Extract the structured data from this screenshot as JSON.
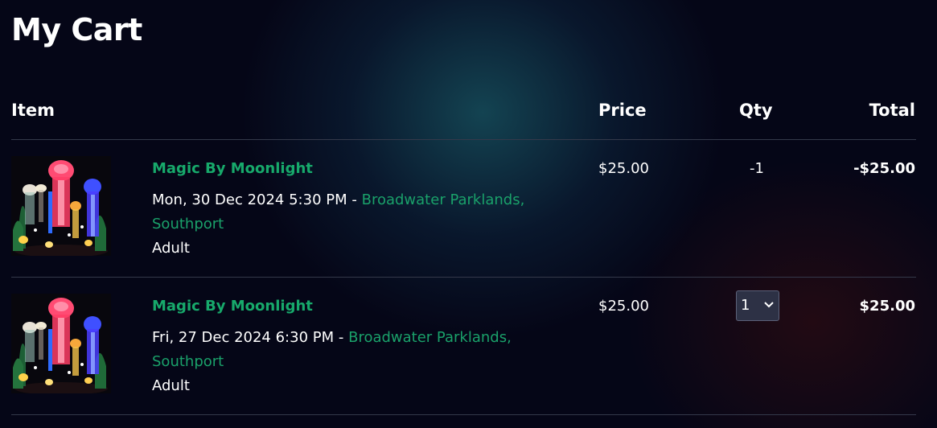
{
  "page": {
    "title": "My Cart"
  },
  "table": {
    "headers": {
      "item": "Item",
      "price": "Price",
      "qty": "Qty",
      "total": "Total"
    }
  },
  "cart_items": [
    {
      "image_icon": "lantern-jellyfish-photo",
      "event_name": "Magic By Moonlight",
      "datetime": "Mon, 30 Dec 2024 5:30 PM",
      "separator": "-",
      "venue": "Broadwater Parklands, Southport",
      "ticket_type": "Adult",
      "price": "$25.00",
      "qty": "-1",
      "total": "-$25.00"
    },
    {
      "image_icon": "lantern-jellyfish-photo",
      "event_name": "Magic By Moonlight",
      "datetime": "Fri, 27 Dec 2024 6:30 PM",
      "separator": "-",
      "venue": "Broadwater Parklands, Southport",
      "ticket_type": "Adult",
      "price": "$25.00",
      "qty_selected": "1",
      "qty_control_icon": "chevron-down-icon",
      "total": "$25.00"
    }
  ],
  "colors": {
    "background": "#050617",
    "accent_green": "#17a96b",
    "text": "#ffffff",
    "divider": "#34394a",
    "select_background": "#2d3145"
  }
}
